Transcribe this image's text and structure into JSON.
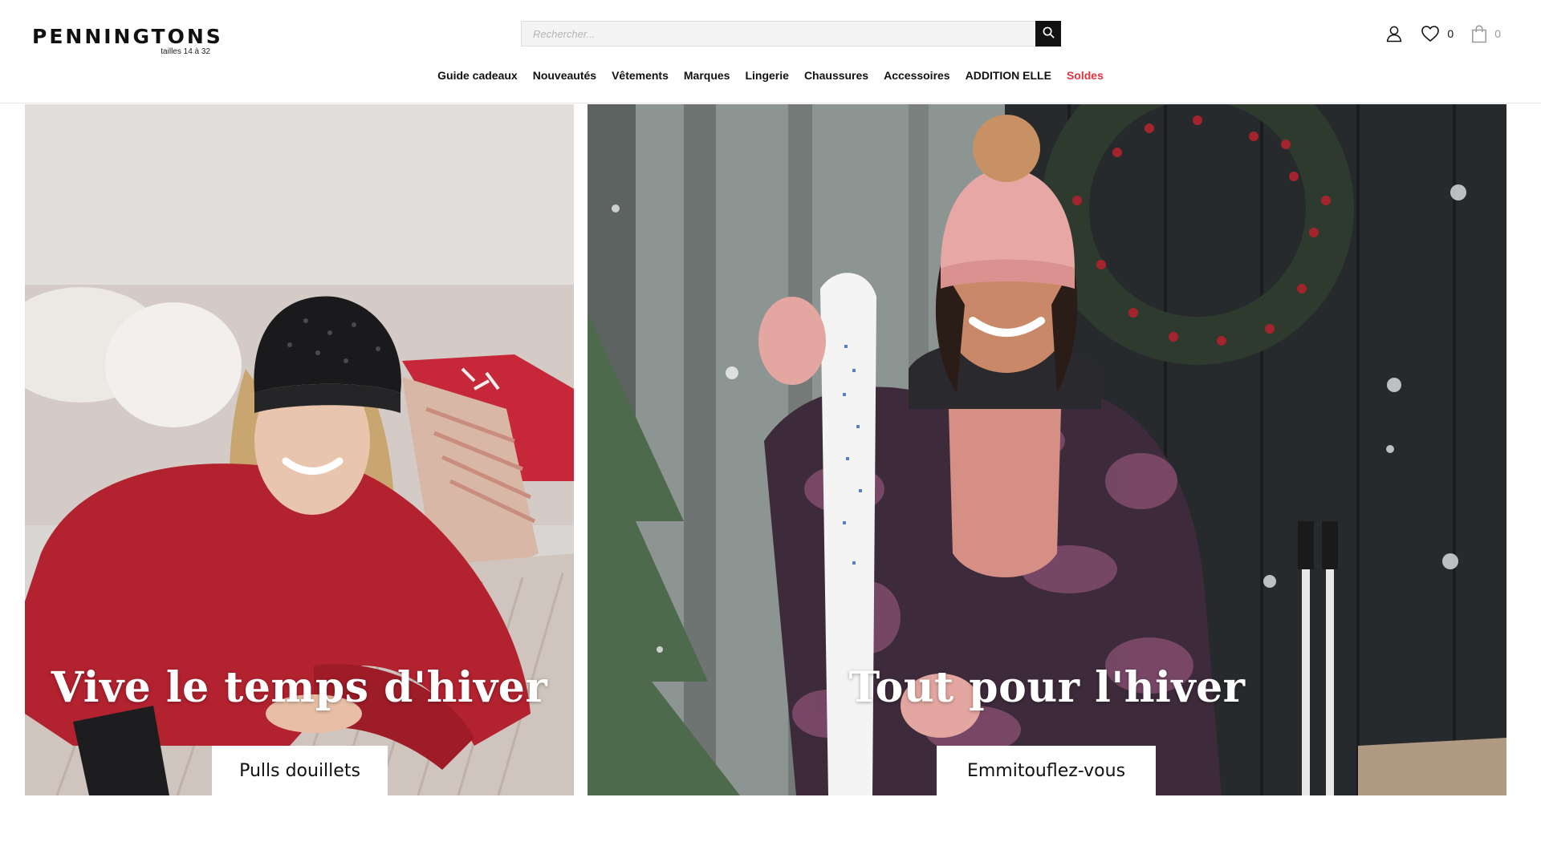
{
  "brand": {
    "name": "PENNINGTONS",
    "tagline": "tailles 14 à 32"
  },
  "search": {
    "placeholder": "Rechercher...",
    "value": "",
    "button_icon": "search-icon"
  },
  "utilities": {
    "account_icon": "user-icon",
    "wishlist": {
      "icon": "heart-icon",
      "count": "0"
    },
    "cart": {
      "icon": "shopping-bag-icon",
      "count": "0"
    }
  },
  "nav": {
    "items": [
      {
        "label": "Guide cadeaux"
      },
      {
        "label": "Nouveautés"
      },
      {
        "label": "Vêtements"
      },
      {
        "label": "Marques"
      },
      {
        "label": "Lingerie"
      },
      {
        "label": "Chaussures"
      },
      {
        "label": "Accessoires"
      },
      {
        "label": "ADDITION ELLE"
      },
      {
        "label": "Soldes"
      }
    ]
  },
  "hero": {
    "left": {
      "headline": "Vive le temps d'hiver",
      "cta": "Pulls douillets",
      "image": "woman in red knit sweater and black beanie lounging on sofa with cushions"
    },
    "right": {
      "headline": "Tout pour l'hiver",
      "cta": "Emmitouflez-vous",
      "image": "woman in pink beanie and floral ski jacket holding skis outside a cabin with wreath"
    }
  },
  "colors": {
    "text": "#111111",
    "sale": "#e0343f",
    "search_button": "#111111",
    "search_field": "#f4f4f4",
    "cta_background": "#ffffff"
  }
}
